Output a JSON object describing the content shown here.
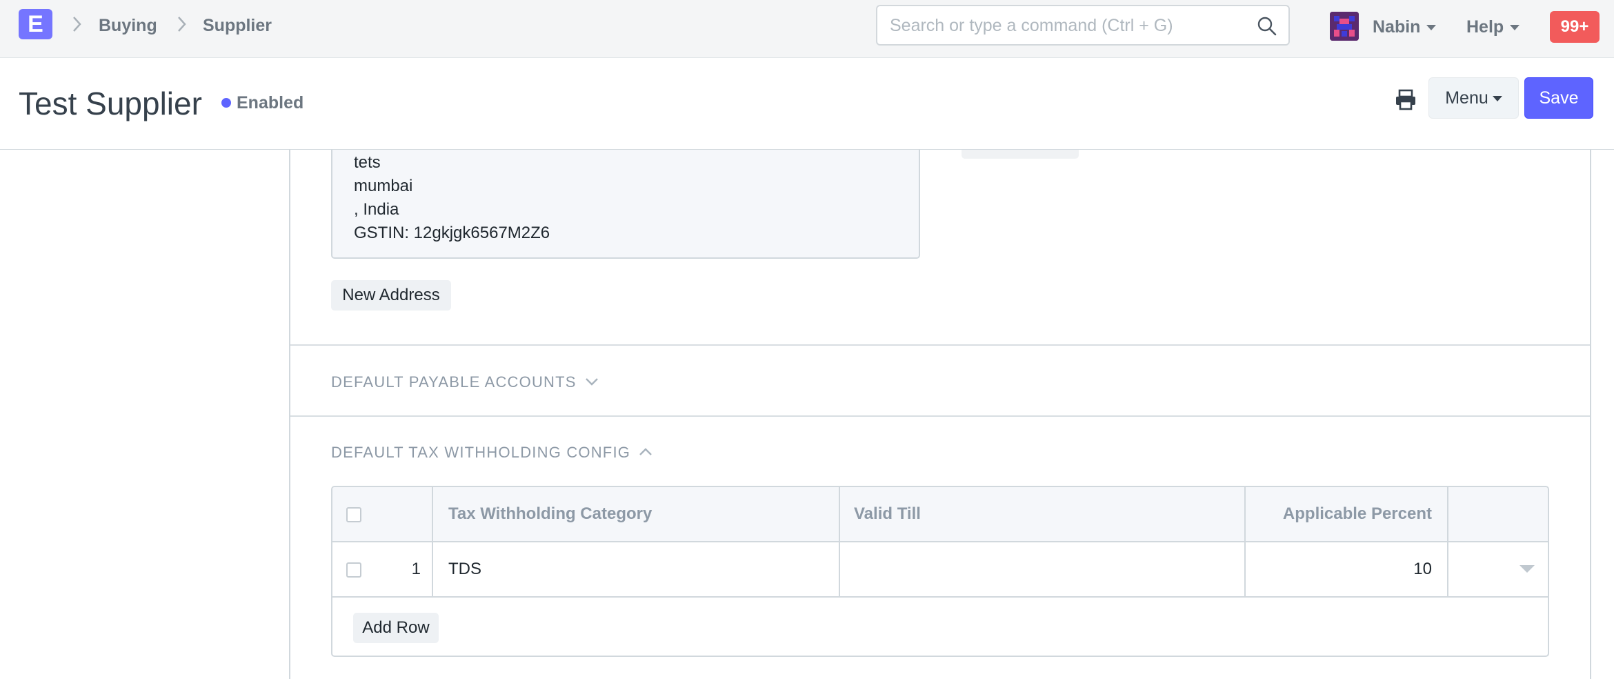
{
  "app": {
    "logo_letter": "E"
  },
  "breadcrumbs": [
    "Buying",
    "Supplier"
  ],
  "search": {
    "placeholder": "Search or type a command (Ctrl + G)"
  },
  "user_menu": {
    "label": "Nabin"
  },
  "help_menu": {
    "label": "Help"
  },
  "notifications": {
    "count": "99+",
    "color": "#f25b5b"
  },
  "page": {
    "title": "Test Supplier",
    "status": "Enabled",
    "status_color": "#5e64ff",
    "menu_label": "Menu",
    "save_label": "Save",
    "accent": "#5e64ff"
  },
  "address": {
    "lines": [
      "tets",
      "mumbai",
      ", India",
      "GSTIN: 12gkjgk6567M2Z6"
    ],
    "new_button": "New Address"
  },
  "sections": {
    "payable_accounts": {
      "label": "DEFAULT PAYABLE ACCOUNTS",
      "state": "collapsed"
    },
    "tax_withholding": {
      "label": "DEFAULT TAX WITHHOLDING CONFIG",
      "state": "expanded"
    }
  },
  "table": {
    "columns": [
      "Tax Withholding Category",
      "Valid Till",
      "Applicable Percent"
    ],
    "rows": [
      {
        "idx": "1",
        "category": "TDS",
        "valid_till": "",
        "percent": "10"
      }
    ],
    "add_row_label": "Add Row"
  },
  "icons": [
    "search-icon",
    "printer-icon",
    "chevron-down-icon",
    "chevron-up-icon",
    "chevron-right-icon",
    "caret-down-icon"
  ]
}
